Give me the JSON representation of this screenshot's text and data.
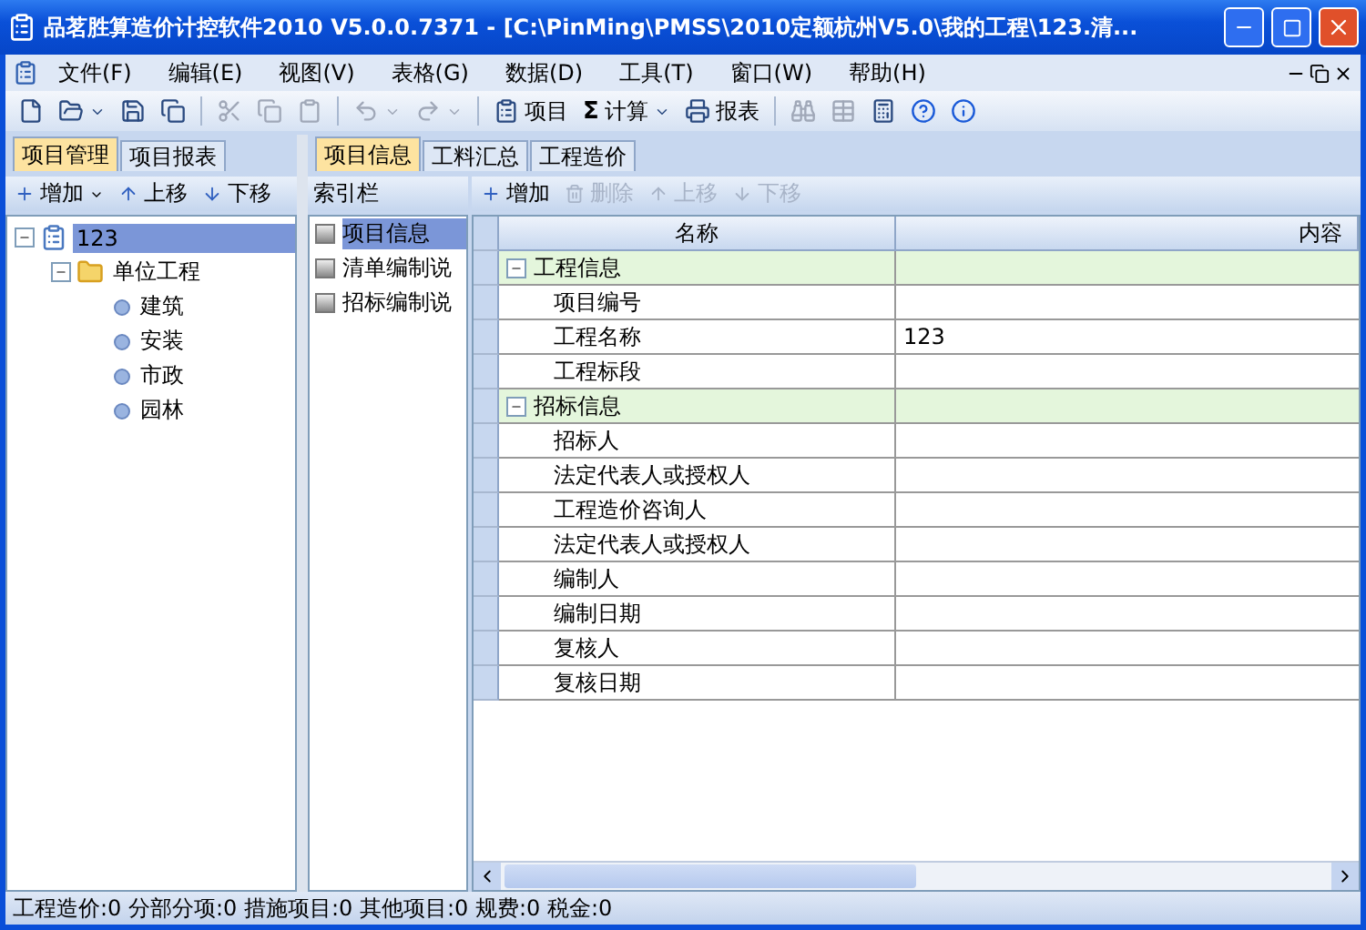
{
  "window": {
    "title": "品茗胜算造价计控软件2010 V5.0.0.7371 - [C:\\PinMing\\PMSS\\2010定额杭州V5.0\\我的工程\\123.清..."
  },
  "menu": [
    "文件(F)",
    "编辑(E)",
    "视图(V)",
    "表格(G)",
    "数据(D)",
    "工具(T)",
    "窗口(W)",
    "帮助(H)"
  ],
  "toolbar": [
    {
      "kind": "new",
      "disabled": false
    },
    {
      "kind": "open",
      "disabled": false
    },
    {
      "kind": "save",
      "disabled": false
    },
    {
      "kind": "save-all",
      "disabled": false
    },
    {
      "kind": "sep"
    },
    {
      "kind": "cut",
      "disabled": true
    },
    {
      "kind": "copy",
      "disabled": true
    },
    {
      "kind": "paste",
      "disabled": true
    },
    {
      "kind": "sep"
    },
    {
      "kind": "undo",
      "disabled": true
    },
    {
      "kind": "redo",
      "disabled": true
    },
    {
      "kind": "sep"
    },
    {
      "kind": "project",
      "label": "项目",
      "disabled": false
    },
    {
      "kind": "sigma",
      "label": "计算",
      "symbol": "Σ",
      "disabled": false
    },
    {
      "kind": "report",
      "label": "报表",
      "disabled": false
    },
    {
      "kind": "sep"
    },
    {
      "kind": "find",
      "disabled": true
    },
    {
      "kind": "table",
      "disabled": true
    },
    {
      "kind": "calc",
      "disabled": false
    },
    {
      "kind": "help",
      "disabled": false
    },
    {
      "kind": "info",
      "disabled": false
    }
  ],
  "left_tabs": [
    {
      "label": "项目管理",
      "selected": true
    },
    {
      "label": "项目报表",
      "selected": false
    }
  ],
  "left_toolbar": [
    {
      "kind": "add",
      "label": "增加",
      "dropdown": true
    },
    {
      "kind": "up",
      "label": "上移",
      "dropdown": false
    },
    {
      "kind": "down",
      "label": "下移",
      "dropdown": false
    }
  ],
  "tree": [
    {
      "label": "123",
      "kind": "project",
      "selected": true,
      "expanded": true,
      "children": [
        {
          "label": "单位工程",
          "kind": "folder",
          "selected": false,
          "expanded": true,
          "children": [
            {
              "label": "建筑",
              "kind": "leaf",
              "selected": false
            },
            {
              "label": "安装",
              "kind": "leaf",
              "selected": false
            },
            {
              "label": "市政",
              "kind": "leaf",
              "selected": false
            },
            {
              "label": "园林",
              "kind": "leaf",
              "selected": false
            }
          ]
        }
      ]
    }
  ],
  "main_tabs": [
    {
      "label": "项目信息",
      "selected": true
    },
    {
      "label": "工料汇总",
      "selected": false
    },
    {
      "label": "工程造价",
      "selected": false
    }
  ],
  "index_panel": {
    "title": "索引栏",
    "items": [
      {
        "label": "项目信息",
        "selected": true
      },
      {
        "label": "清单编制说",
        "selected": false
      },
      {
        "label": "招标编制说",
        "selected": false
      }
    ]
  },
  "grid_toolbar": [
    {
      "kind": "add",
      "label": "增加",
      "disabled": false
    },
    {
      "kind": "delete",
      "label": "删除",
      "disabled": true
    },
    {
      "kind": "up",
      "label": "上移",
      "disabled": true
    },
    {
      "kind": "down",
      "label": "下移",
      "disabled": true
    }
  ],
  "grid": {
    "columns": [
      "名称",
      "内容"
    ],
    "groups": [
      {
        "name": "工程信息",
        "expanded": true,
        "rows": [
          {
            "name": "项目编号"
          },
          {
            "name": "工程名称",
            "value": "123"
          },
          {
            "name": "工程标段"
          }
        ]
      },
      {
        "name": "招标信息",
        "expanded": true,
        "rows": [
          {
            "name": "招标人"
          },
          {
            "name": "法定代表人或授权人"
          },
          {
            "name": "工程造价咨询人"
          },
          {
            "name": "法定代表人或授权人"
          },
          {
            "name": "编制人"
          },
          {
            "name": "编制日期"
          },
          {
            "name": "复核人"
          },
          {
            "name": "复核日期"
          }
        ]
      }
    ]
  },
  "status_bar": "工程造价:0 分部分项:0 措施项目:0 其他项目:0 规费:0 税金:0"
}
